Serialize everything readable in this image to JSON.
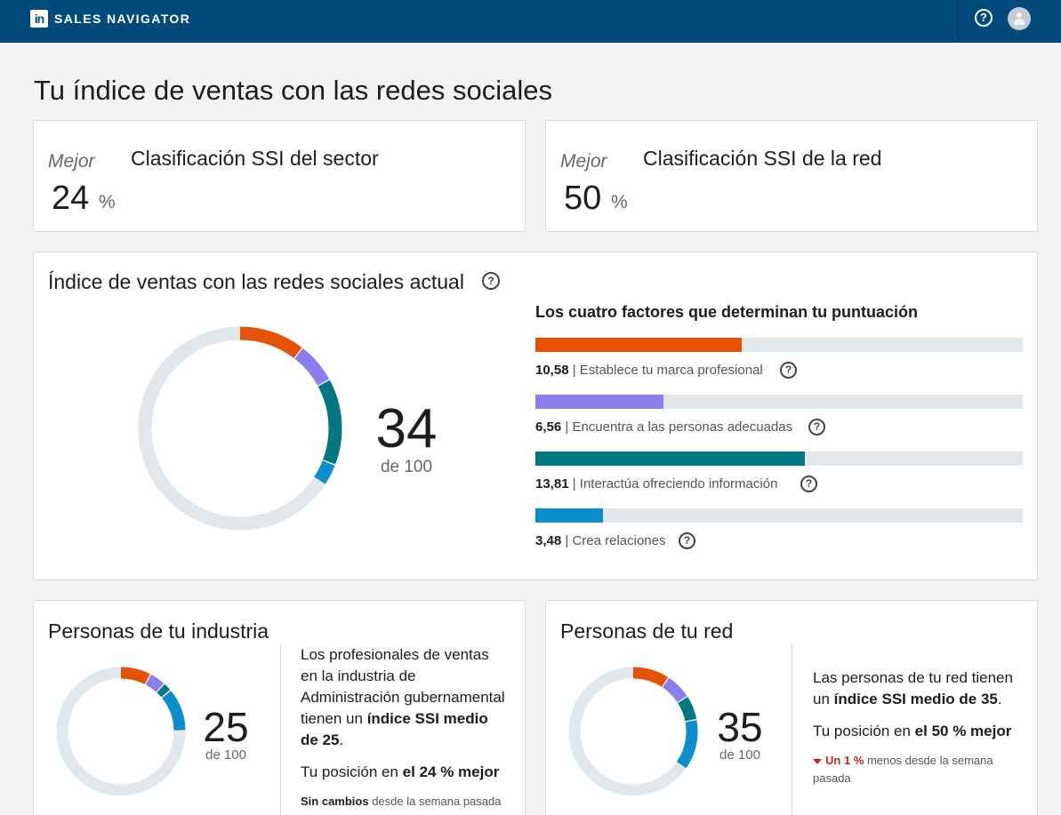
{
  "header": {
    "brand_label": "SALES NAVIGATOR",
    "logo_text": "in"
  },
  "page_title": "Tu índice de ventas con las redes sociales",
  "industry_rank": {
    "qualifier": "Mejor",
    "value": "24",
    "unit": "%",
    "title": "Clasificación SSI del sector"
  },
  "network_rank": {
    "qualifier": "Mejor",
    "value": "50",
    "unit": "%",
    "title": "Clasificación SSI de la red"
  },
  "ssi_current": {
    "title": "Índice de ventas con las redes sociales actual",
    "score": "34",
    "score_sub": "de 100",
    "factors_title": "Los cuatro factores que determinan tu puntuación",
    "factors": [
      {
        "value": "10,58",
        "label": "Establece tu marca profesional",
        "score": 10.58,
        "max": 25,
        "color": "#e35205"
      },
      {
        "value": "6,56",
        "label": "Encuentra a las personas adecuadas",
        "score": 6.56,
        "max": 25,
        "color": "#8c7eec"
      },
      {
        "value": "13,81",
        "label": "Interactúa ofreciendo información",
        "score": 13.81,
        "max": 25,
        "color": "#007781"
      },
      {
        "value": "3,48",
        "label": "Crea relaciones",
        "score": 3.48,
        "max": 25,
        "color": "#0b8ecc"
      }
    ]
  },
  "industry_people": {
    "title": "Personas de tu industria",
    "score": "25",
    "score_sub": "de 100",
    "segments": [
      7.8,
      4.1,
      2.2,
      10.9
    ],
    "desc_line1": "Los profesionales de ventas en la industria de Administración gubernamental tienen un ",
    "desc_bold": "índice SSI medio de 25",
    "desc_end": ".",
    "position_prefix": "Tu posición en ",
    "position_bold": "el 24 % mejor",
    "change_bold": "Sin cambios",
    "change_rest": " desde la semana pasada"
  },
  "network_people": {
    "title": "Personas de tu red",
    "score": "35",
    "score_sub": "de 100",
    "segments": [
      9.4,
      6.6,
      6.2,
      12.8
    ],
    "desc_line1": "Las personas de tu red tienen un ",
    "desc_bold": "índice SSI medio de 35",
    "desc_end": ".",
    "position_prefix": "Tu posición en ",
    "position_bold": "el 50 % mejor",
    "change_red": "Un 1 %",
    "change_rest": " menos desde la semana pasada"
  },
  "colors": {
    "brand": "#e35205",
    "find": "#8c7eec",
    "engage": "#007781",
    "build": "#0b8ecc",
    "track": "#e2e7ec",
    "header": "#004b7c"
  }
}
